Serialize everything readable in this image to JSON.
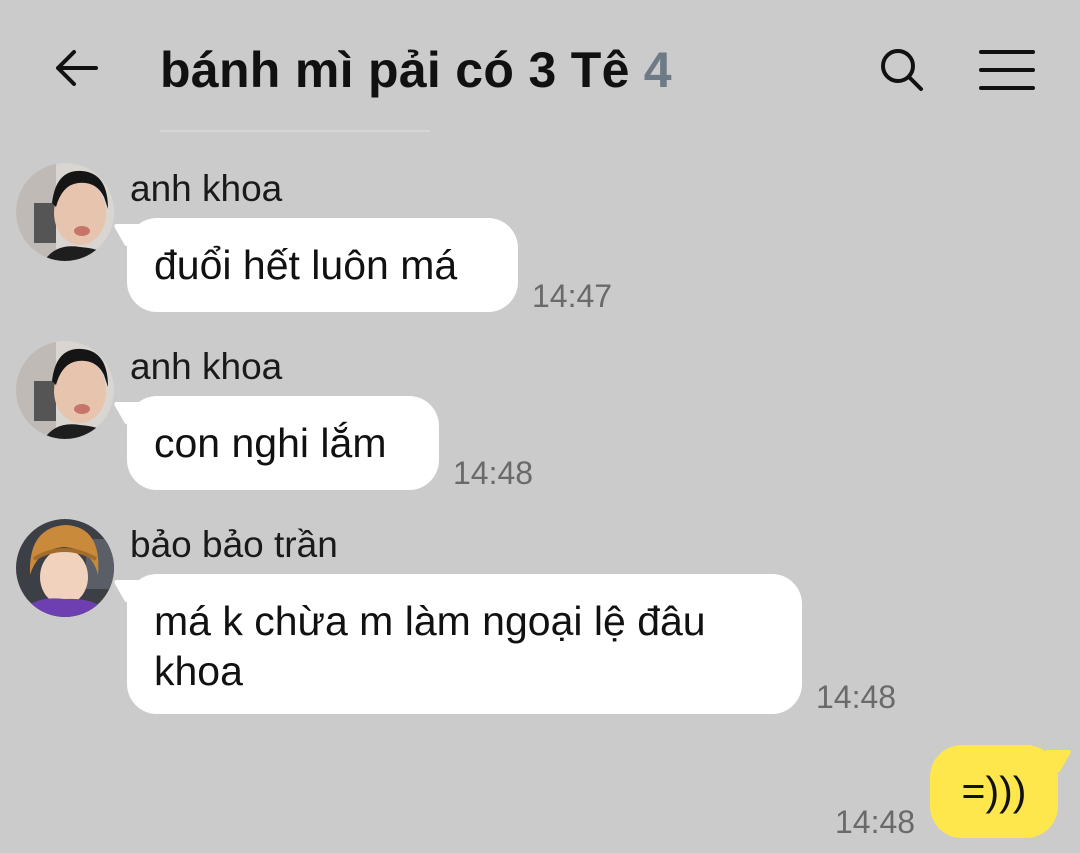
{
  "header": {
    "title": "bánh mì pải có 3 Tê",
    "member_count": "4"
  },
  "messages": [
    {
      "sender": "anh khoa",
      "text": "đuổi hết luôn má",
      "time": "14:47",
      "avatar": "avatar-anh-khoa"
    },
    {
      "sender": "anh khoa",
      "text": "con nghi lắm",
      "time": "14:48",
      "avatar": "avatar-anh-khoa"
    },
    {
      "sender": "bảo bảo trần",
      "text_line1": "má k chừa m làm ngoại lệ đâu",
      "text_line2": "khoa",
      "time": "14:48",
      "avatar": "avatar-bao-bao-tran"
    }
  ],
  "own_message": {
    "text": "=)))",
    "time": "14:48"
  },
  "colors": {
    "background": "#cbcbcb",
    "own_bubble": "#fde74d",
    "other_bubble": "#ffffff",
    "member_count": "#6e7a86"
  }
}
